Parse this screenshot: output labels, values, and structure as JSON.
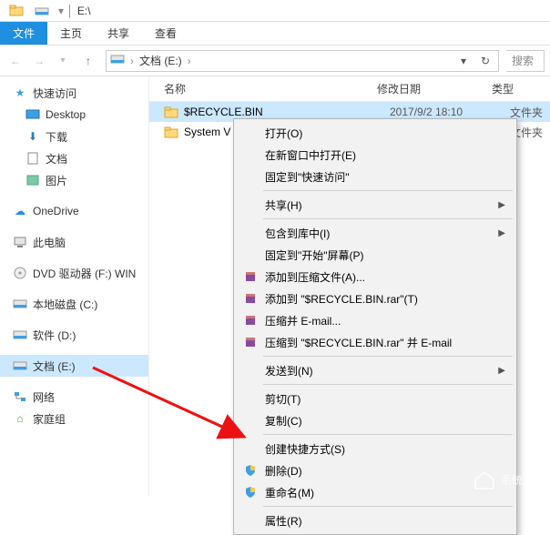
{
  "window": {
    "title": "E:\\"
  },
  "ribbon": {
    "file": "文件",
    "home": "主页",
    "share": "共享",
    "view": "查看"
  },
  "nav": {
    "crumb1": "文档 (E:)",
    "search_placeholder": "搜索"
  },
  "tree": {
    "quick": "快速访问",
    "desktop": "Desktop",
    "downloads": "下载",
    "documents": "文档",
    "pictures": "图片",
    "onedrive": "OneDrive",
    "thispc": "此电脑",
    "dvd": "DVD 驱动器 (F:) WIN",
    "localc": "本地磁盘 (C:)",
    "softd": "软件 (D:)",
    "doce": "文档 (E:)",
    "network": "网络",
    "homegroup": "家庭组"
  },
  "columns": {
    "name": "名称",
    "date": "修改日期",
    "type": "类型"
  },
  "rows": [
    {
      "name": "$RECYCLE.BIN",
      "date": "2017/9/2 18:10",
      "type": "文件夹",
      "selected": true
    },
    {
      "name": "System V",
      "date": "",
      "type": "文件夹",
      "selected": false
    }
  ],
  "menu": {
    "open": "打开(O)",
    "open_new_window": "在新窗口中打开(E)",
    "pin_quick": "固定到\"快速访问\"",
    "share": "共享(H)",
    "include_library": "包含到库中(I)",
    "pin_start": "固定到\"开始\"屏幕(P)",
    "add_archive": "添加到压缩文件(A)...",
    "add_archive_name": "添加到 \"$RECYCLE.BIN.rar\"(T)",
    "compress_email": "压缩并 E-mail...",
    "compress_name_email": "压缩到 \"$RECYCLE.BIN.rar\" 并 E-mail",
    "send_to": "发送到(N)",
    "cut": "剪切(T)",
    "copy": "复制(C)",
    "create_shortcut": "创建快捷方式(S)",
    "delete": "删除(D)",
    "rename": "重命名(M)",
    "properties": "属性(R)"
  },
  "watermark": "系统之家"
}
